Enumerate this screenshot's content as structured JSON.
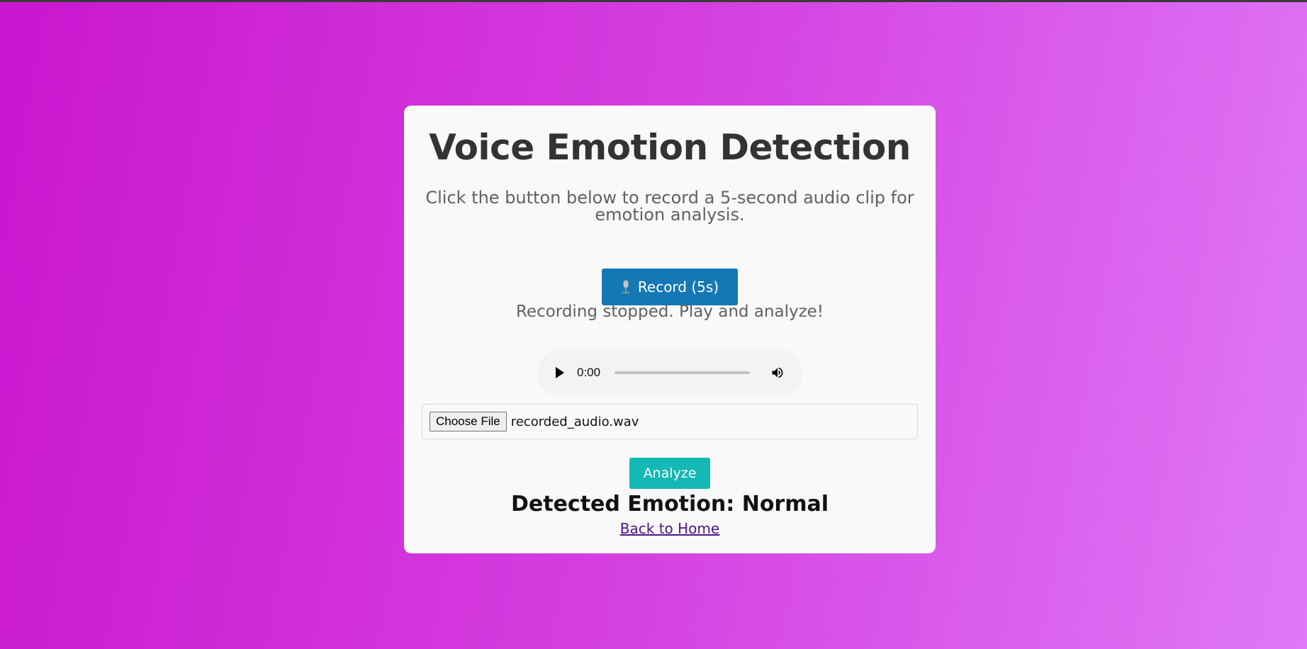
{
  "page": {
    "title": "Voice Emotion Detection",
    "subtitle": "Click the button below to record a 5-second audio clip for emotion analysis."
  },
  "record": {
    "label": "Record (5s)",
    "icon": "microphone-icon",
    "status": "Recording stopped. Play and analyze!"
  },
  "audio_player": {
    "time": "0:00",
    "progress": 0,
    "play_icon": "play-icon",
    "volume_icon": "volume-icon"
  },
  "file_input": {
    "button_label": "Choose File",
    "file_name": "recorded_audio.wav"
  },
  "analyze": {
    "label": "Analyze"
  },
  "result": {
    "text": "Detected Emotion: Normal"
  },
  "nav": {
    "back_home": "Back to Home"
  },
  "colors": {
    "background_start": "#c916cf",
    "background_end": "#de78f7",
    "record_button": "#1478b4",
    "analyze_button": "#14b8b4",
    "link": "#4b1587"
  }
}
